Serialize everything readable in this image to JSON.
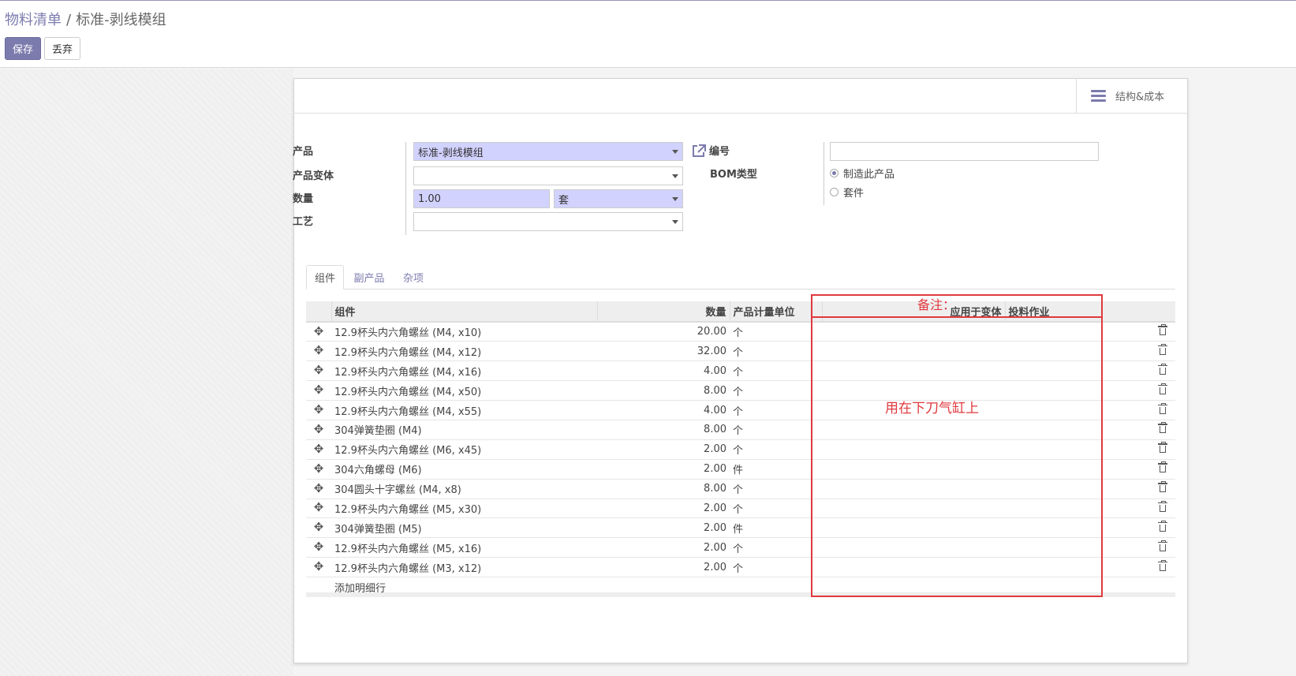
{
  "breadcrumb": {
    "parent": "物料清单",
    "separator": "/",
    "current": "标准-剥线模组"
  },
  "buttons": {
    "save": "保存",
    "discard": "丢弃"
  },
  "smart_button": {
    "label": "结构&成本",
    "icon": "bars-icon"
  },
  "form": {
    "product": {
      "label": "产品",
      "value": "标准-剥线模组"
    },
    "variant": {
      "label": "产品变体",
      "value": ""
    },
    "quantity": {
      "label": "数量",
      "value": "1.00",
      "uom": "套"
    },
    "routing": {
      "label": "工艺",
      "value": ""
    },
    "reference": {
      "label": "编号",
      "value": ""
    },
    "bom_type": {
      "label": "BOM类型",
      "options": [
        "制造此产品",
        "套件"
      ],
      "selected": "制造此产品"
    }
  },
  "tabs": [
    "组件",
    "副产品",
    "杂项"
  ],
  "table": {
    "headers": {
      "component": "组件",
      "quantity": "数量",
      "uom": "产品计量单位",
      "variants": "应用于变体",
      "operation": "投料作业"
    },
    "rows": [
      {
        "component": "12.9杯头内六角螺丝 (M4, x10)",
        "qty": "20.00",
        "uom": "个"
      },
      {
        "component": "12.9杯头内六角螺丝 (M4, x12)",
        "qty": "32.00",
        "uom": "个"
      },
      {
        "component": "12.9杯头内六角螺丝 (M4, x16)",
        "qty": "4.00",
        "uom": "个"
      },
      {
        "component": "12.9杯头内六角螺丝 (M4, x50)",
        "qty": "8.00",
        "uom": "个"
      },
      {
        "component": "12.9杯头内六角螺丝 (M4, x55)",
        "qty": "4.00",
        "uom": "个"
      },
      {
        "component": "304弹簧垫圈 (M4)",
        "qty": "8.00",
        "uom": "个"
      },
      {
        "component": "12.9杯头内六角螺丝 (M6, x45)",
        "qty": "2.00",
        "uom": "个"
      },
      {
        "component": "304六角螺母 (M6)",
        "qty": "2.00",
        "uom": "件"
      },
      {
        "component": "304圆头十字螺丝 (M4, x8)",
        "qty": "8.00",
        "uom": "个"
      },
      {
        "component": "12.9杯头内六角螺丝 (M5, x30)",
        "qty": "2.00",
        "uom": "个"
      },
      {
        "component": "304弹簧垫圈 (M5)",
        "qty": "2.00",
        "uom": "件"
      },
      {
        "component": "12.9杯头内六角螺丝 (M5, x16)",
        "qty": "2.00",
        "uom": "个"
      },
      {
        "component": "12.9杯头内六角螺丝 (M3, x12)",
        "qty": "2.00",
        "uom": "个"
      }
    ],
    "add_line": "添加明细行"
  },
  "annotation": {
    "label": "备注：",
    "note": "用在下刀气缸上",
    "color": "#e0393e"
  },
  "colors": {
    "brand": "#7c7bad",
    "required_field": "#d2d2ff"
  }
}
